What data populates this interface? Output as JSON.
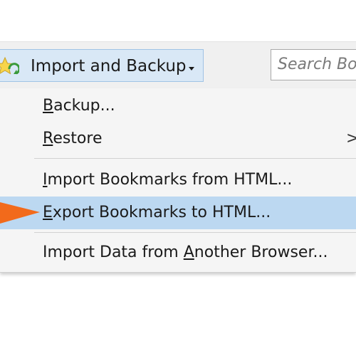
{
  "toolbar": {
    "import_backup_label": "Import and Backup",
    "search_placeholder": "Search Bo"
  },
  "menu": {
    "items": [
      {
        "label_underline": "B",
        "label_rest": "ackup...",
        "name": "backup"
      },
      {
        "label_underline": "R",
        "label_rest": "estore",
        "name": "restore",
        "submenu_arrow": ">"
      },
      {
        "label_pre": "",
        "label_underline": "I",
        "label_rest": "mport Bookmarks from HTML...",
        "name": "import-bookmarks-html"
      },
      {
        "label_underline": "E",
        "label_rest": "xport Bookmarks to HTML...",
        "name": "export-bookmarks-html",
        "highlighted": true
      },
      {
        "label_pre": "Import Data from ",
        "label_underline": "A",
        "label_rest": "nother Browser...",
        "name": "import-data-browser"
      }
    ]
  },
  "colors": {
    "highlight": "#bcd8f1",
    "button_bg": "#d9e8f6",
    "pointer_arrow": "#f26a1b"
  },
  "icons": {
    "import_backup": "star-refresh-icon",
    "submenu": "chevron-right-icon",
    "pointer": "orange-arrow-pointer"
  }
}
